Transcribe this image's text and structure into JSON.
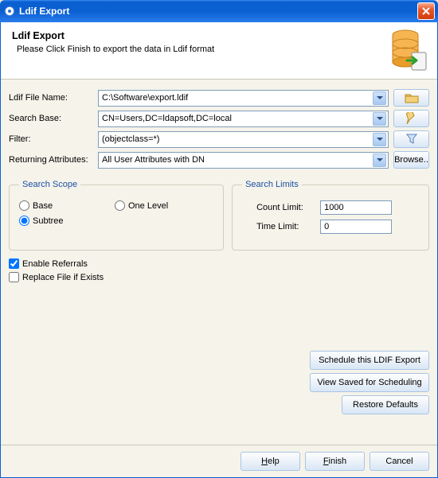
{
  "window": {
    "title": "Ldif Export"
  },
  "header": {
    "title": "Ldif Export",
    "subtitle": "Please Click Finish to export the data in Ldif format"
  },
  "labels": {
    "file_name": "Ldif File Name:",
    "search_base": "Search Base:",
    "filter": "Filter:",
    "returning_attrs": "Returning Attributes:"
  },
  "fields": {
    "file_name": "C:\\Software\\export.ldif",
    "search_base": "CN=Users,DC=ldapsoft,DC=local",
    "filter": "(objectclass=*)",
    "returning_attrs": "All User Attributes with DN"
  },
  "buttons": {
    "browse": "Browse..",
    "schedule": "Schedule this LDIF Export",
    "view_saved": "View Saved for Scheduling",
    "restore": "Restore Defaults",
    "help": "Help",
    "finish": "Finish",
    "cancel": "Cancel"
  },
  "scope": {
    "legend": "Search Scope",
    "base": "Base",
    "one_level": "One Level",
    "subtree": "Subtree",
    "selected": "subtree"
  },
  "limits": {
    "legend": "Search Limits",
    "count_label": "Count Limit:",
    "count_value": "1000",
    "time_label": "Time Limit:",
    "time_value": "0"
  },
  "checks": {
    "enable_referrals": "Enable Referrals",
    "replace_file": "Replace File if Exists"
  }
}
